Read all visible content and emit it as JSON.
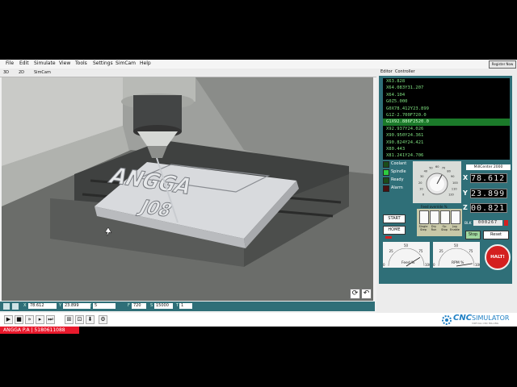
{
  "menu": [
    "File",
    "Edit",
    "Simulate",
    "View",
    "Tools",
    "Settings",
    "SimCam",
    "Help"
  ],
  "register_badge": "Register Now",
  "view_tabs": [
    "3D",
    "2D",
    "SimCam"
  ],
  "right_tabs": [
    "Editor",
    "Controller"
  ],
  "gcode_lines": [
    {
      "text": "X63.828",
      "active": false
    },
    {
      "text": "X64.083Y31.207",
      "active": false
    },
    {
      "text": "X64.104",
      "active": false
    },
    {
      "text": "G0Z5.000",
      "active": false
    },
    {
      "text": "G0X78.412Y23.899",
      "active": false
    },
    {
      "text": "G1Z-2.700F720.0",
      "active": false
    },
    {
      "text": "G1X92.886F2520.0",
      "active": true
    },
    {
      "text": "X92.937Y24.026",
      "active": false
    },
    {
      "text": "X90.950Y24.361",
      "active": false
    },
    {
      "text": "X90.824Y24.421",
      "active": false
    },
    {
      "text": "X80.443",
      "active": false
    },
    {
      "text": "X81.241Y24.706",
      "active": false
    }
  ],
  "status_lights": [
    {
      "label": "Coolant",
      "color": "#1a4d1a"
    },
    {
      "label": "Spindle",
      "color": "#2ecc40"
    },
    {
      "label": "Ready",
      "color": "#1a4d1a"
    },
    {
      "label": "Alarm",
      "color": "#4a1010"
    }
  ],
  "feed_override_label": "Feed override %",
  "feed_knob_ticks": [
    "0",
    "10",
    "20",
    "30",
    "40",
    "50",
    "60",
    "70",
    "80",
    "90",
    "100",
    "110",
    "120"
  ],
  "machine_title": "MillCenter 2000",
  "axes": [
    {
      "axis": "X",
      "value": "78.612"
    },
    {
      "axis": "Y",
      "value": "23.899"
    },
    {
      "axis": "Z",
      "value": "00.821"
    }
  ],
  "blk_label": "BLK",
  "blk_value": "000267",
  "start_label": "START",
  "home_label": "HOME",
  "switches": [
    "Single Step",
    "Dry Run",
    "Op Stop",
    "Jog Enable"
  ],
  "stop_label": "Stop",
  "reset_label": "Reset",
  "feed_gauge": {
    "label": "Feed %",
    "ticks": [
      "0",
      "25",
      "50",
      "75",
      "100"
    ],
    "level_percent": 82
  },
  "rpm_gauge": {
    "label": "RPM %",
    "ticks": [
      "0",
      "25",
      "50",
      "75",
      "100"
    ],
    "level_percent": 95
  },
  "halt_label": "HALT!",
  "dro": {
    "x": "78.612",
    "y": "23.899",
    "z": "5",
    "f": "720",
    "s": "15000",
    "t": "1"
  },
  "dro_labels": [
    "X",
    "Y",
    "Z",
    "F",
    "S",
    "T"
  ],
  "logo": {
    "cnc": "CNC",
    "simulator": "SIMULATOR",
    "sub": "VIRTUAL CNC MILLING"
  },
  "watermark": "ANGGA P.A | 5180611088",
  "colors": {
    "panel": "#2f6f78",
    "active_line": "#1b7a2a",
    "halt": "#d42020",
    "code_text": "#7fe080"
  }
}
